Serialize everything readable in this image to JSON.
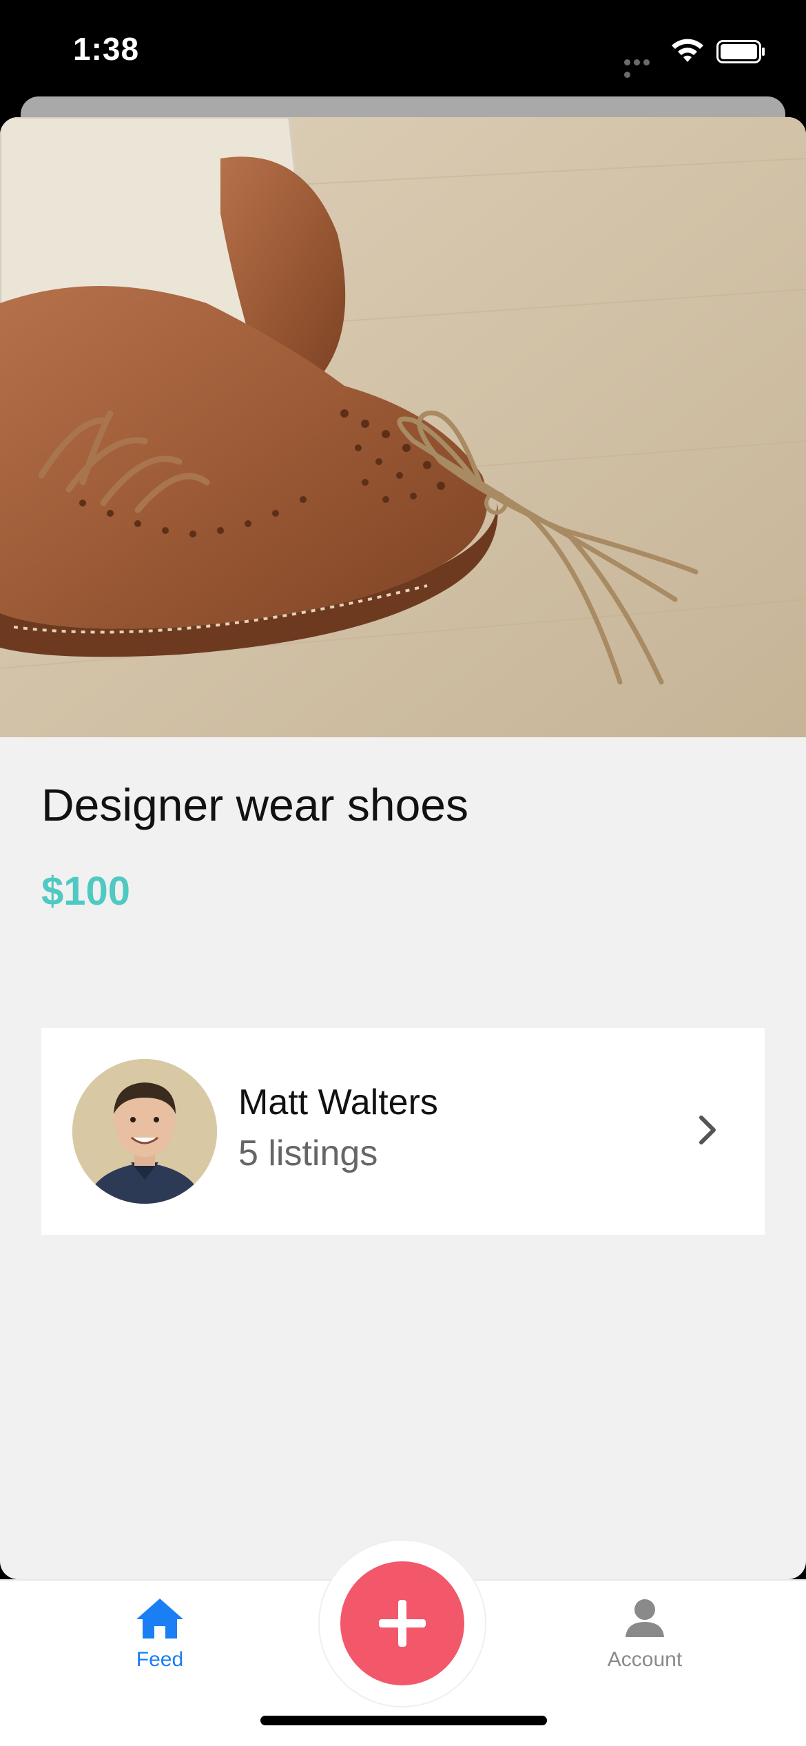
{
  "status_bar": {
    "time": "1:38"
  },
  "listing": {
    "title": "Designer wear shoes",
    "price": "$100",
    "price_color": "#4fc9c2",
    "image_icon": "product-photo-brogue-shoes"
  },
  "seller": {
    "name": "Matt Walters",
    "listings": "5 listings"
  },
  "tab_bar": {
    "feed_label": "Feed",
    "account_label": "Account",
    "active_color": "#1a7ef5",
    "inactive_color": "#8a8a8a",
    "fab_color": "#f2576a"
  }
}
